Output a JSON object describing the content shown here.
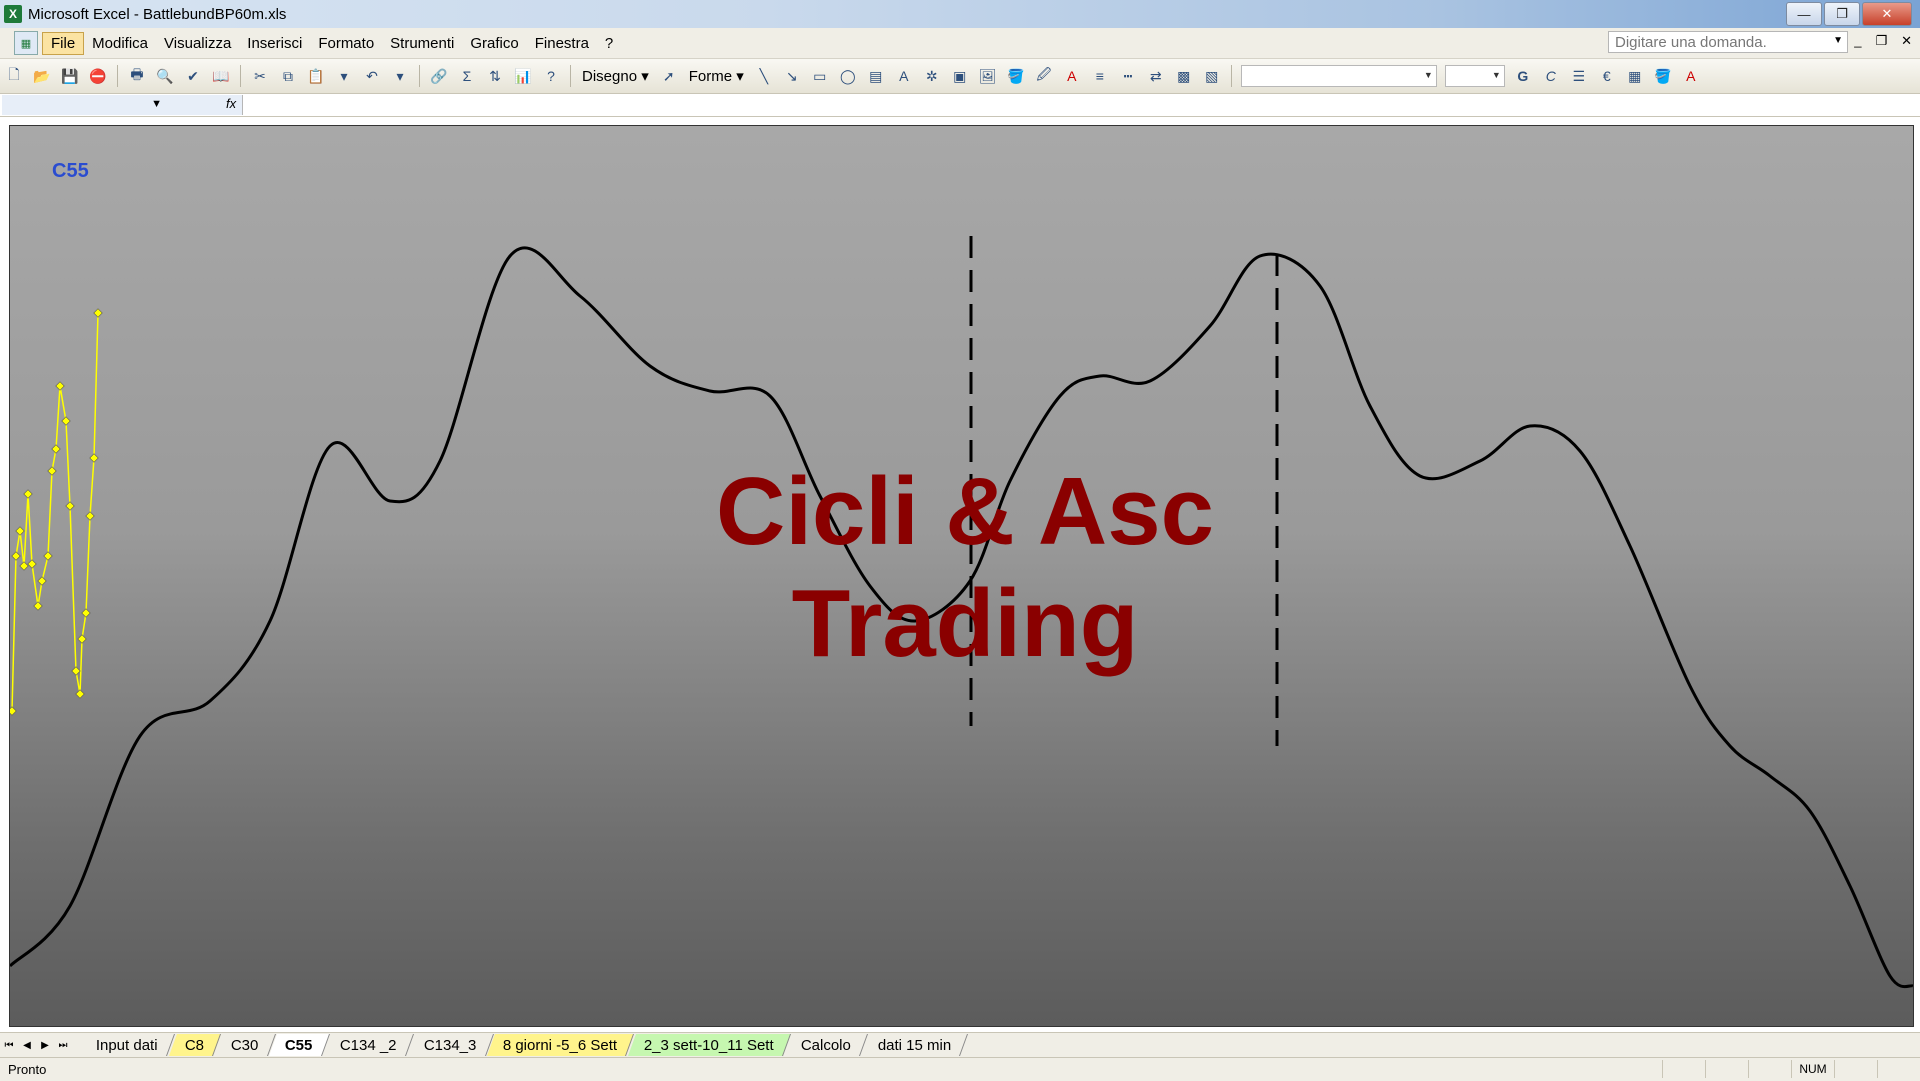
{
  "window": {
    "title": "Microsoft Excel - BattlebundBP60m.xls",
    "controls": [
      "—",
      "❐",
      "✕"
    ]
  },
  "menu": {
    "items": [
      "File",
      "Modifica",
      "Visualizza",
      "Inserisci",
      "Formato",
      "Strumenti",
      "Grafico",
      "Finestra",
      "?"
    ],
    "ask_placeholder": "Digitare una domanda."
  },
  "toolbar": {
    "draw_label": "Disegno",
    "shapes_label": "Forme",
    "bold": "G",
    "italic": "C"
  },
  "chart": {
    "sheet_label": "C55",
    "watermark_line1": "Cicli & Asc",
    "watermark_line2": "Trading"
  },
  "tabs": [
    {
      "label": "Input dati",
      "style": "normal"
    },
    {
      "label": "C8",
      "style": "yellow"
    },
    {
      "label": "C30",
      "style": "normal"
    },
    {
      "label": "C55",
      "style": "active"
    },
    {
      "label": "C134 _2",
      "style": "normal"
    },
    {
      "label": "C134_3",
      "style": "normal"
    },
    {
      "label": "8 giorni -5_6 Sett",
      "style": "yellow"
    },
    {
      "label": "2_3 sett-10_11 Sett",
      "style": "green"
    },
    {
      "label": "Calcolo",
      "style": "normal"
    },
    {
      "label": "dati 15 min",
      "style": "normal"
    }
  ],
  "status": {
    "text": "Pronto",
    "num": "NUM"
  },
  "colors": {
    "cycle_line": "#000000",
    "price_line": "#ffff00",
    "watermark": "#8a0000",
    "sheet_label": "#2a4cd0"
  }
}
